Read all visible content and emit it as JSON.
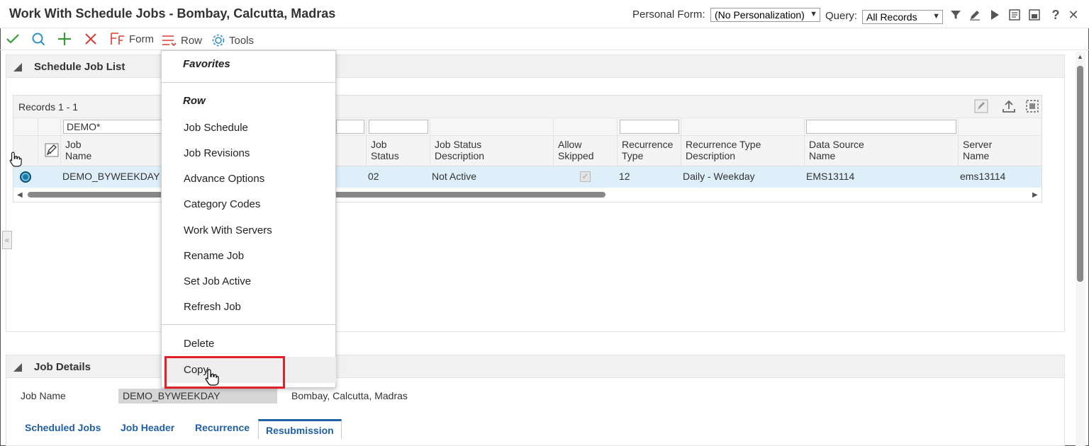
{
  "window": {
    "title": "Work With Schedule Jobs - Bombay, Calcutta, Madras",
    "personal_form_label": "Personal Form:",
    "personal_form_value": "(No Personalization)",
    "query_label": "Query:",
    "query_value": "All Records"
  },
  "toolbar": {
    "form_label": "Form",
    "row_label": "Row",
    "tools_label": "Tools"
  },
  "schedule_job_list": {
    "title": "Schedule Job List",
    "records_label": "Records 1 - 1",
    "qbe_job_name": "DEMO*",
    "columns": [
      {
        "line1": "Job",
        "line2": "Name"
      },
      {
        "line1": "Job",
        "line2": "Status"
      },
      {
        "line1": "Job Status",
        "line2": "Description"
      },
      {
        "line1": "Allow",
        "line2": "Skipped"
      },
      {
        "line1": "Recurrence",
        "line2": "Type"
      },
      {
        "line1": "Recurrence Type",
        "line2": "Description"
      },
      {
        "line1": "Data Source",
        "line2": "Name"
      },
      {
        "line1": "Server",
        "line2": "Name"
      }
    ],
    "row": {
      "job_name": "DEMO_BYWEEKDAY",
      "job_status": "02",
      "job_status_description": "Not Active",
      "recurrence_type": "12",
      "recurrence_type_description": "Daily - Weekday",
      "data_source_name": "EMS13114",
      "server_name": "ems13114",
      "allow_skipped": true
    }
  },
  "row_menu": {
    "favorites_header": "Favorites",
    "row_header": "Row",
    "items": [
      "Job Schedule",
      "Job Revisions",
      "Advance Options",
      "Category Codes",
      "Work With Servers",
      "Rename Job",
      "Set Job Active",
      "Refresh Job"
    ],
    "delete_label": "Delete",
    "copy_label": "Copy"
  },
  "job_details": {
    "title": "Job Details",
    "job_name_label": "Job Name",
    "job_name_value": "DEMO_BYWEEKDAY",
    "job_name_description": "Bombay, Calcutta, Madras",
    "tabs": [
      "Scheduled Jobs",
      "Job Header",
      "Recurrence",
      "Resubmission"
    ],
    "active_tab": "Resubmission"
  },
  "colors": {
    "accent_blue": "#1f5fa5",
    "selected_row": "#dfeffa",
    "highlight_red": "#e0202a",
    "ok_green": "#3a9a3a",
    "cancel_red": "#e0382e"
  }
}
